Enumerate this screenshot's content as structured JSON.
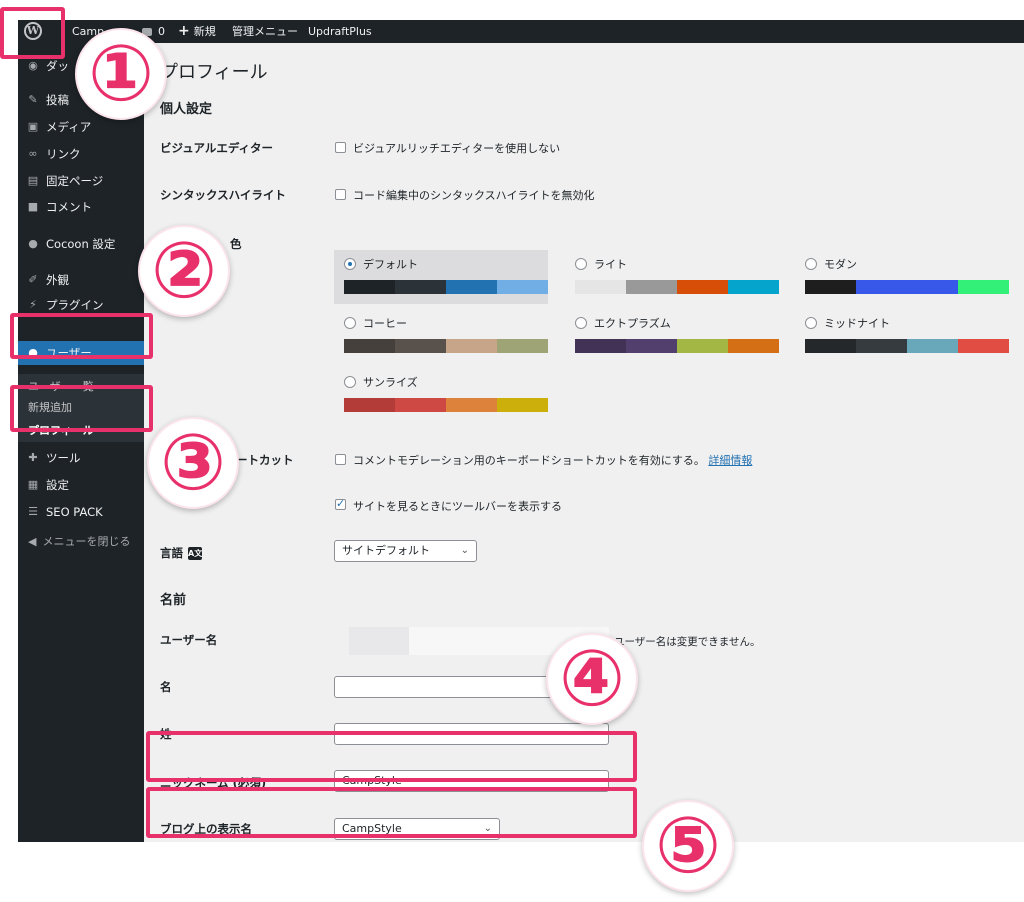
{
  "admin_bar": {
    "site_name": "Camp",
    "comments_count": "0",
    "new_label": "新規",
    "admin_menu_label": "管理メニュー",
    "updraft_label": "UpdraftPlus"
  },
  "sidebar": {
    "items": [
      {
        "label": "ダッ",
        "icon": "dashboard-icon"
      },
      {
        "label": "投稿",
        "icon": "pin-icon"
      },
      {
        "label": "メディア",
        "icon": "media-icon"
      },
      {
        "label": "リンク",
        "icon": "link-icon"
      },
      {
        "label": "固定ページ",
        "icon": "page-icon"
      },
      {
        "label": "コメント",
        "icon": "comment-icon"
      },
      {
        "label": "Cocoon 設定",
        "icon": "cocoon-icon"
      },
      {
        "label": "外観",
        "icon": "appearance-icon"
      },
      {
        "label": "プラグイン",
        "icon": "plugin-icon"
      },
      {
        "label": "ユーザー",
        "icon": "user-icon"
      },
      {
        "label": "ツール",
        "icon": "wrench-icon"
      },
      {
        "label": "設定",
        "icon": "settings-icon"
      },
      {
        "label": "SEO PACK",
        "icon": "seo-icon"
      }
    ],
    "submenu": [
      "ユーザー一覧",
      "新規追加",
      "プロフィール"
    ],
    "collapse_label": "メニューを閉じる"
  },
  "page": {
    "title": "プロフィール",
    "personal_settings": "個人設定",
    "visual_editor_label": "ビジュアルエディター",
    "visual_editor_option": "ビジュアルリッチエディターを使用しない",
    "syntax_label": "シンタックスハイライト",
    "syntax_option": "コード編集中のシンタックスハイライトを無効化",
    "scheme_label": "色",
    "keyboard_label": "ートカット",
    "keyboard_option": "コメントモデレーション用のキーボードショートカットを有効にする。",
    "keyboard_link": "詳細情報",
    "toolbar_option": "サイトを見るときにツールバーを表示する",
    "language_label": "言語",
    "language_value": "サイトデフォルト",
    "name_section": "名前",
    "username_label": "ユーザー名",
    "username_help": "ユーザー名は変更できません。",
    "first_name_label": "名",
    "last_name_label": "姓",
    "nickname_label": "ニックネーム (必須)",
    "nickname_value": "CampStyle",
    "display_name_label": "ブログ上の表示名",
    "display_name_value": "CampStyle"
  },
  "color_schemes": [
    {
      "name": "デフォルト",
      "colors": [
        "#1d2327",
        "#2c3338",
        "#2271b1",
        "#72aee6"
      ],
      "selected": true
    },
    {
      "name": "ライト",
      "colors": [
        "#e5e5e5",
        "#999999",
        "#d64e07",
        "#04a4cc"
      ],
      "selected": false
    },
    {
      "name": "モダン",
      "colors": [
        "#1e1e1e",
        "#3858e9",
        "#3858e9",
        "#33f078"
      ],
      "selected": false
    },
    {
      "name": "コーヒー",
      "colors": [
        "#46403c",
        "#59524c",
        "#c7a589",
        "#9ea476"
      ],
      "selected": false
    },
    {
      "name": "エクトプラズム",
      "colors": [
        "#413256",
        "#523f6d",
        "#a3b745",
        "#d46f15"
      ],
      "selected": false
    },
    {
      "name": "ミッドナイト",
      "colors": [
        "#25282b",
        "#363b3f",
        "#69a8bb",
        "#e14d43"
      ],
      "selected": false
    },
    {
      "name": "サンライズ",
      "colors": [
        "#b43c38",
        "#cf4944",
        "#dd823b",
        "#ccaf0b"
      ],
      "selected": false
    }
  ],
  "annotations": [
    "①",
    "②",
    "③",
    "④",
    "⑤"
  ],
  "colors": {
    "highlight": "#e8306b",
    "admin_dark": "#1d2327",
    "accent": "#2271b1"
  }
}
